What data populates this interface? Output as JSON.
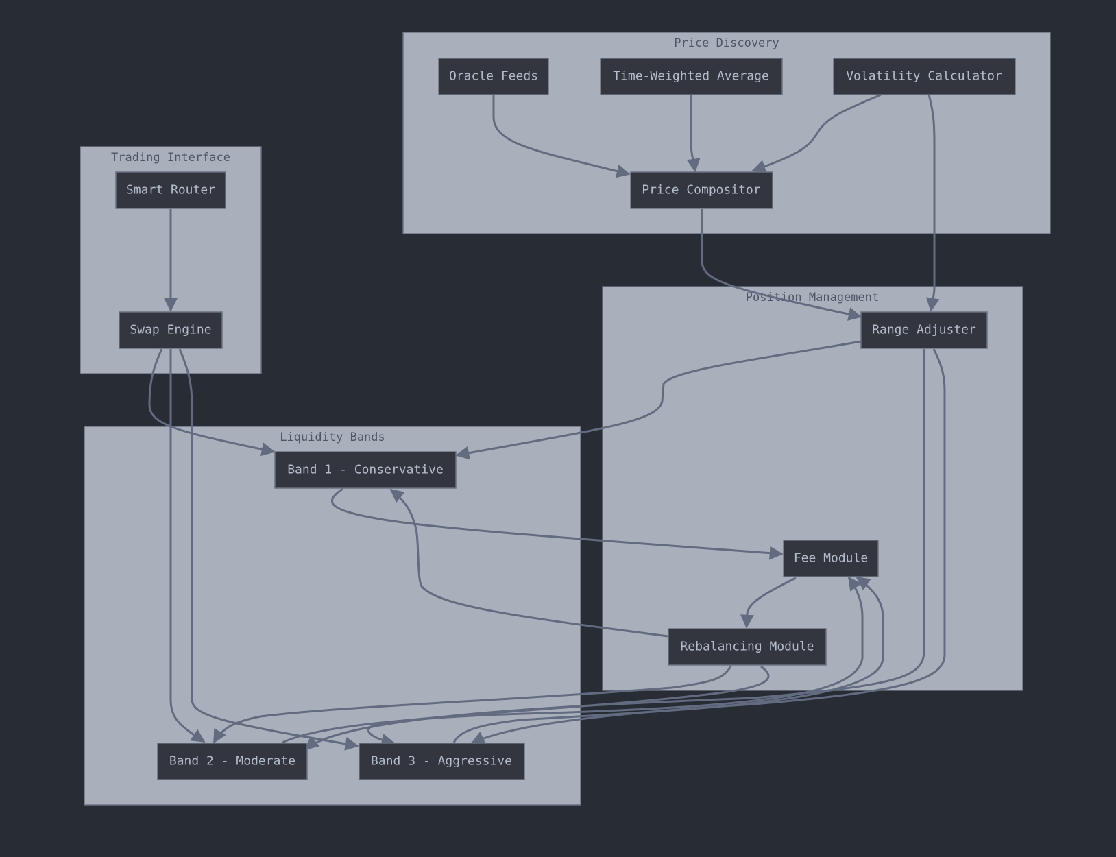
{
  "diagram": {
    "type": "flowchart",
    "colors": {
      "background": "#282c35",
      "cluster_fill": "#a9b0bc",
      "node_fill": "#33363f",
      "node_text": "#b4bccb",
      "edge": "#626b80"
    },
    "clusters": [
      {
        "id": "price_discovery",
        "label": "Price Discovery"
      },
      {
        "id": "trading_interface",
        "label": "Trading Interface"
      },
      {
        "id": "position_management",
        "label": "Position Management"
      },
      {
        "id": "liquidity_bands",
        "label": "Liquidity Bands"
      }
    ],
    "nodes": [
      {
        "id": "oracle",
        "label": "Oracle Feeds",
        "cluster": "price_discovery"
      },
      {
        "id": "twa",
        "label": "Time-Weighted Average",
        "cluster": "price_discovery"
      },
      {
        "id": "vol",
        "label": "Volatility Calculator",
        "cluster": "price_discovery"
      },
      {
        "id": "compositor",
        "label": "Price Compositor",
        "cluster": "price_discovery"
      },
      {
        "id": "router",
        "label": "Smart Router",
        "cluster": "trading_interface"
      },
      {
        "id": "swap",
        "label": "Swap Engine",
        "cluster": "trading_interface"
      },
      {
        "id": "range",
        "label": "Range Adjuster",
        "cluster": "position_management"
      },
      {
        "id": "fee",
        "label": "Fee Module",
        "cluster": "position_management"
      },
      {
        "id": "rebal",
        "label": "Rebalancing Module",
        "cluster": "position_management"
      },
      {
        "id": "band1",
        "label": "Band 1 - Conservative",
        "cluster": "liquidity_bands"
      },
      {
        "id": "band2",
        "label": "Band 2 - Moderate",
        "cluster": "liquidity_bands"
      },
      {
        "id": "band3",
        "label": "Band 3 - Aggressive",
        "cluster": "liquidity_bands"
      }
    ],
    "edges": [
      {
        "from": "oracle",
        "to": "compositor"
      },
      {
        "from": "twa",
        "to": "compositor"
      },
      {
        "from": "vol",
        "to": "compositor"
      },
      {
        "from": "vol",
        "to": "range"
      },
      {
        "from": "compositor",
        "to": "range"
      },
      {
        "from": "router",
        "to": "swap"
      },
      {
        "from": "swap",
        "to": "band1"
      },
      {
        "from": "swap",
        "to": "band2"
      },
      {
        "from": "swap",
        "to": "band3"
      },
      {
        "from": "range",
        "to": "band1"
      },
      {
        "from": "range",
        "to": "band2"
      },
      {
        "from": "range",
        "to": "band3"
      },
      {
        "from": "band1",
        "to": "fee"
      },
      {
        "from": "band2",
        "to": "fee"
      },
      {
        "from": "band3",
        "to": "fee"
      },
      {
        "from": "fee",
        "to": "rebal"
      },
      {
        "from": "rebal",
        "to": "band1"
      },
      {
        "from": "rebal",
        "to": "band2"
      },
      {
        "from": "rebal",
        "to": "band3"
      }
    ]
  }
}
